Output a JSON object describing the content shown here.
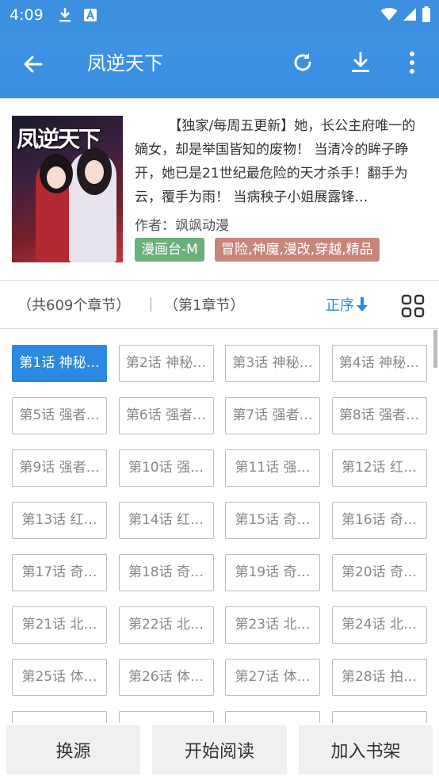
{
  "status_bar": {
    "time": "4:09",
    "icons": [
      "download-icon",
      "app-a-icon",
      "wifi-icon",
      "signal-icon",
      "battery-icon"
    ]
  },
  "app_bar": {
    "title": "凤逆天下",
    "actions": [
      "refresh-icon",
      "download-icon",
      "more-vert-icon"
    ],
    "color": "#3d8fe0"
  },
  "book": {
    "cover_title": "凤逆天下",
    "description": "【独家/每周五更新】她，长公主府唯一的嫡女，却是举国皆知的废物！ 当清冷的眸子睁开，她已是21世纪最危险的天才杀手！翻手为云，覆手为雨！ 当病秧子小姐展露锋…",
    "author": "作者：飒飒动漫",
    "source_tag": "漫画台-M",
    "genre_tag": "冒险,神魔,漫改,穿越,精品"
  },
  "chapter_bar": {
    "total": "（共609个章节）",
    "current": "（第1章节）",
    "order_label": "正序",
    "order_icon": "arrow-down-icon",
    "layout_icon": "grid-icon"
  },
  "chapters": [
    "第1话 神秘…",
    "第2话 神秘…",
    "第3话 神秘…",
    "第4话 神秘…",
    "第5话 强者…",
    "第6话 强者…",
    "第7话 强者…",
    "第8话 强者…",
    "第9话 强者…",
    "第10话 强…",
    "第11话 强…",
    "第12话 红…",
    "第13话 红…",
    "第14话 红…",
    "第15话 奇…",
    "第16话 奇…",
    "第17话 奇…",
    "第18话 奇…",
    "第19话 奇…",
    "第20话 奇…",
    "第21话 北…",
    "第22话 北…",
    "第23话 北…",
    "第24话 北…",
    "第25话 体…",
    "第26话 体…",
    "第27话 体…",
    "第28话 拍…",
    "",
    "",
    "",
    ""
  ],
  "active_chapter_index": 0,
  "bottom_actions": {
    "change_source": "换源",
    "start_reading": "开始阅读",
    "add_to_shelf": "加入书架"
  },
  "colors": {
    "accent": "#2b8ae0",
    "source_tag_bg": "#6cb07c",
    "genre_tag_bg": "#c8867b"
  }
}
